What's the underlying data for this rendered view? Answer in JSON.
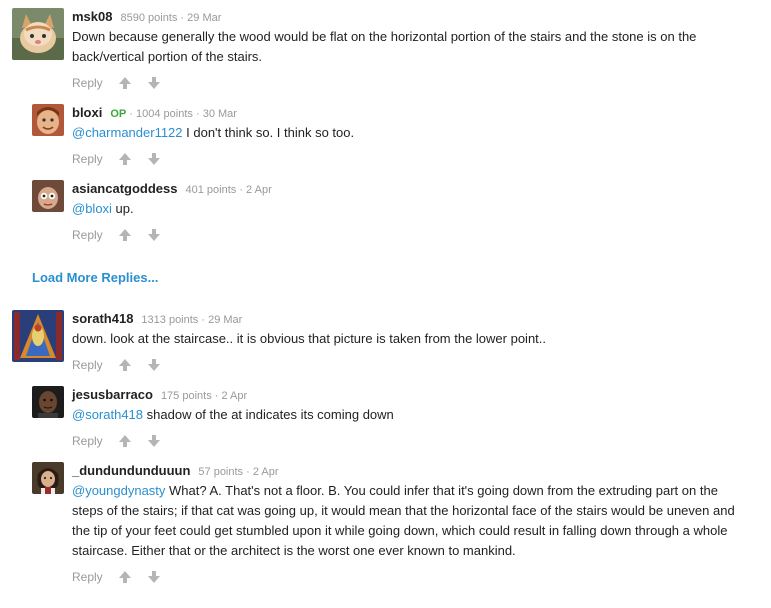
{
  "comments": [
    {
      "username": "msk08",
      "op": "",
      "points": "8590 points",
      "date": "29 Mar",
      "mention": "",
      "text": "Down because generally the wood would be flat on the horizontal portion of the stairs and the stone is on the back/vertical portion of the stairs.",
      "reply_label": "Reply"
    },
    {
      "username": "bloxi",
      "op": "OP",
      "points": "1004 points",
      "date": "30 Mar",
      "mention": "@charmander1122",
      "text": " I don't think so. I think so too.",
      "reply_label": "Reply"
    },
    {
      "username": "asiancatgoddess",
      "op": "",
      "points": "401 points",
      "date": "2 Apr",
      "mention": "@bloxi",
      "text": " up.",
      "reply_label": "Reply"
    },
    {
      "username": "sorath418",
      "op": "",
      "points": "1313 points",
      "date": "29 Mar",
      "mention": "",
      "text": "down. look at the staircase.. it is obvious that picture is taken from the lower point..",
      "reply_label": "Reply"
    },
    {
      "username": "jesusbarraco",
      "op": "",
      "points": "175 points",
      "date": "2 Apr",
      "mention": "@sorath418",
      "text": " shadow of the at indicates its coming down",
      "reply_label": "Reply"
    },
    {
      "username": "_dundundunduuun",
      "op": "",
      "points": "57 points",
      "date": "2 Apr",
      "mention": "@youngdynasty",
      "text": " What? A. That's not a floor. B. You could infer that it's going down from the extruding part on the steps of the stairs; if that cat was going up, it would mean that the horizontal face of the stairs would be uneven and the tip of your feet could get stumbled upon it while going down, which could result in falling down through a whole staircase. Either that or the architect is the worst one ever known to mankind.",
      "reply_label": "Reply"
    }
  ],
  "separator": " · ",
  "load_more_label": "Load More Replies...",
  "icons": {
    "upvote": "arrow-up-icon",
    "downvote": "arrow-down-icon"
  },
  "colors": {
    "link": "#2a8fd0",
    "op_badge": "#3aa83a",
    "meta": "#999999",
    "action": "#9a9a9a"
  }
}
